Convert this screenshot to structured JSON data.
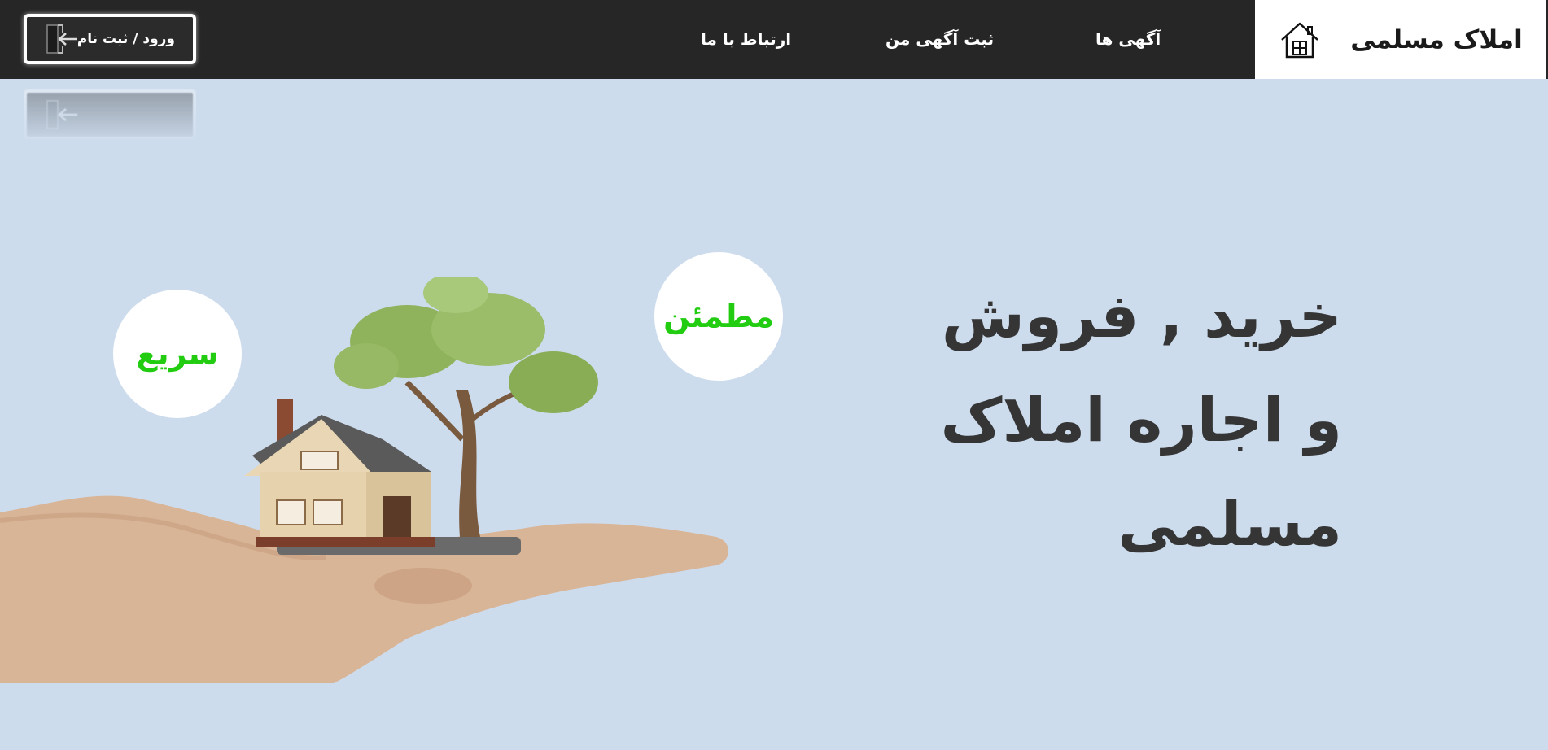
{
  "brand": {
    "title": "املاک مسلمی",
    "icon": "house-icon"
  },
  "nav": {
    "ads": "آگهی ها",
    "post_ad": "ثبت آگهی من",
    "contact": "ارتباط با ما"
  },
  "auth": {
    "login_label": "ورود / ثبت نام",
    "icon": "login-door-icon"
  },
  "hero": {
    "title_line1": "خرید , فروش",
    "title_line2": "و اجاره املاک",
    "title_line3": "مسلمی",
    "badge_reliable": "مطمئن",
    "badge_fast": "سریع"
  },
  "colors": {
    "topbar": "#262626",
    "background": "#cddced",
    "badge_text": "#22cc11",
    "hero_text": "#353535"
  }
}
